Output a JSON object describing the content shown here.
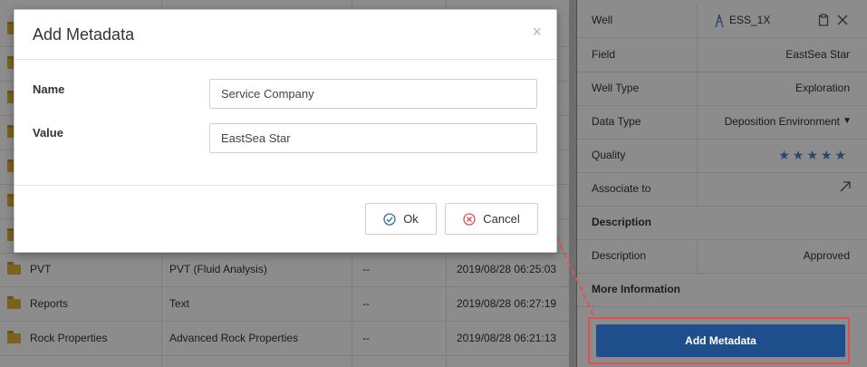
{
  "file_table": {
    "rows": [
      {
        "name": "",
        "type": "",
        "dash": "",
        "date": ""
      },
      {
        "name": "",
        "type": "",
        "dash": "",
        "date": ""
      },
      {
        "name": "",
        "type": "",
        "dash": "",
        "date": ""
      },
      {
        "name": "",
        "type": "",
        "dash": "",
        "date": ""
      },
      {
        "name": "",
        "type": "",
        "dash": "",
        "date": ""
      },
      {
        "name": "",
        "type": "",
        "dash": "",
        "date": ""
      },
      {
        "name": "",
        "type": "",
        "dash": "",
        "date": ""
      },
      {
        "name": "PVT",
        "type": "PVT (Fluid Analysis)",
        "dash": "--",
        "date": "2019/08/28 06:25:03"
      },
      {
        "name": "Reports",
        "type": "Text",
        "dash": "--",
        "date": "2019/08/28 06:27:19"
      },
      {
        "name": "Rock Properties",
        "type": "Advanced Rock Properties",
        "dash": "--",
        "date": "2019/08/28 06:21:13"
      }
    ]
  },
  "panel": {
    "well_label": "Well",
    "well_value": "ESS_1X",
    "field_label": "Field",
    "field_value": "EastSea Star",
    "well_type_label": "Well Type",
    "well_type_value": "Exploration",
    "data_type_label": "Data Type",
    "data_type_value": "Deposition Environment",
    "quality_label": "Quality",
    "quality_stars": 5,
    "quality_display": "★★★★★",
    "associate_label": "Associate to",
    "description_section": "Description",
    "description_label": "Description",
    "description_value": "Approved",
    "more_info_section": "More Information",
    "add_metadata_button": "Add Metadata"
  },
  "modal": {
    "title": "Add Metadata",
    "close_glyph": "×",
    "name_label": "Name",
    "name_value": "Service Company",
    "value_label": "Value",
    "value_value": "EastSea Star",
    "ok_label": "Ok",
    "cancel_label": "Cancel"
  },
  "colors": {
    "primary_button": "#1f4e8c",
    "highlight_red": "#e05050",
    "star_blue": "#4a7fc1",
    "folder_yellow": "#e2b23a"
  }
}
